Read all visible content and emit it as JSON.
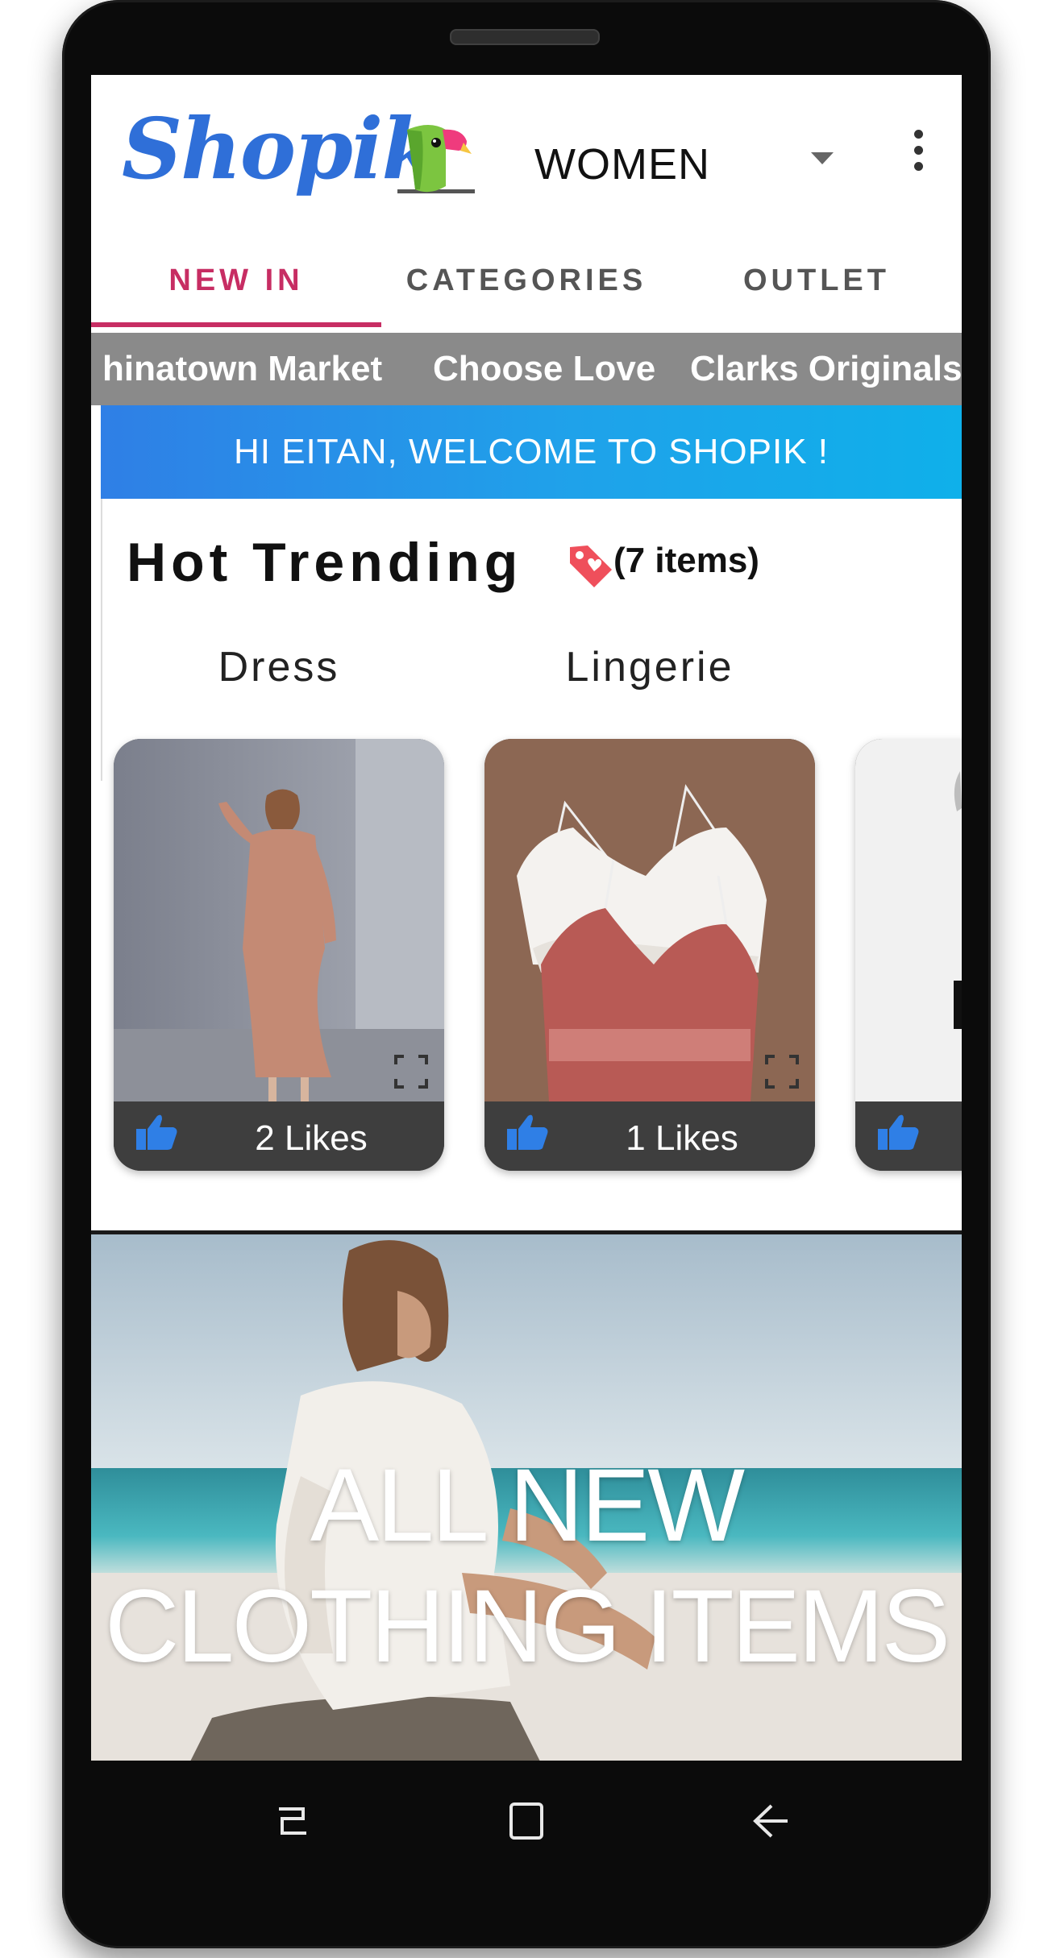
{
  "app": {
    "logo_text": "Shopik",
    "category_selected": "WOMEN"
  },
  "tabs": [
    {
      "label": "NEW IN",
      "active": true
    },
    {
      "label": "CATEGORIES",
      "active": false
    },
    {
      "label": "OUTLET",
      "active": false
    }
  ],
  "brands": [
    "hinatown Market",
    "Choose Love",
    "Clarks Originals"
  ],
  "welcome": "HI EITAN, WELCOME TO SHOPIK !",
  "trending": {
    "title": "Hot Trending",
    "count": "(7 items)",
    "items": [
      {
        "category": "Dress",
        "likes": "2 Likes"
      },
      {
        "category": "Lingerie",
        "likes": "1 Likes"
      },
      {
        "category": "",
        "likes": ""
      }
    ]
  },
  "hero": {
    "line1": "ALL NEW",
    "line2": "CLOTHING ITEMS"
  },
  "colors": {
    "brand_blue": "#2f6fd8",
    "accent_pink": "#c72d63",
    "like_blue": "#2f7fe6",
    "brand_strip": "#8a8a8a"
  },
  "icons": {
    "tag": "tag-icon",
    "like": "thumbs-up-icon",
    "expand": "expand-icon",
    "menu": "more-vert-icon",
    "dropdown": "chevron-down-icon"
  }
}
